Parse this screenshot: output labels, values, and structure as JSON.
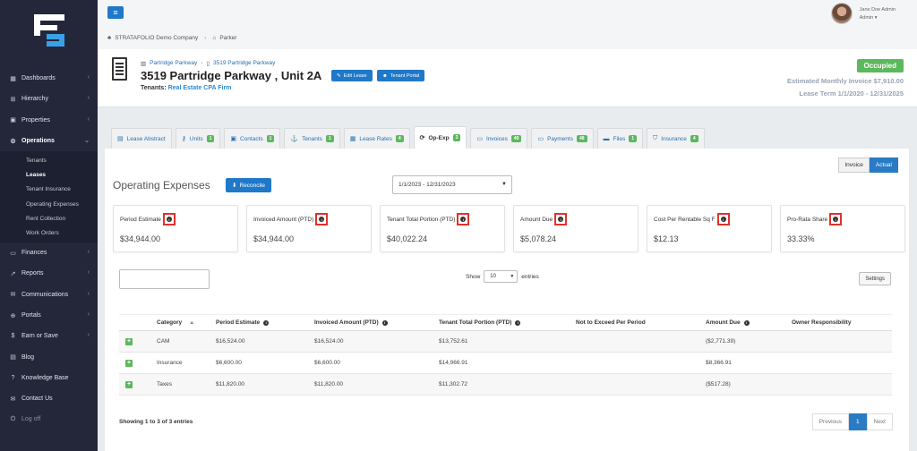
{
  "sidebar": {
    "items": [
      {
        "label": "Dashboards",
        "icon": "dashboard-icon"
      },
      {
        "label": "Hierarchy",
        "icon": "hierarchy-icon"
      },
      {
        "label": "Properties",
        "icon": "briefcase-icon"
      },
      {
        "label": "Operations",
        "icon": "gears-icon"
      },
      {
        "label": "Finances",
        "icon": "money-icon"
      },
      {
        "label": "Reports",
        "icon": "chart-icon"
      },
      {
        "label": "Communications",
        "icon": "chat-icon"
      },
      {
        "label": "Portals",
        "icon": "portal-icon"
      },
      {
        "label": "Earn or Save",
        "icon": "dollar-icon"
      },
      {
        "label": "Blog",
        "icon": "blog-icon"
      },
      {
        "label": "Knowledge Base",
        "icon": "question-icon"
      },
      {
        "label": "Contact Us",
        "icon": "envelope-icon"
      },
      {
        "label": "Log off",
        "icon": "power-icon"
      }
    ],
    "operations_sub": [
      "Tenants",
      "Leases",
      "Tenant Insurance",
      "Operating Expenses",
      "Rent Collection",
      "Work Orders"
    ]
  },
  "topbar": {
    "company": "STRATAFOLIO Demo Company",
    "property": "Parker",
    "user_name": "Jane Doe Admin",
    "user_role": "Admin ▾"
  },
  "lease": {
    "crumb_property": "Partridge Parkway",
    "crumb_unit": "3519 Partridge Parkway",
    "title": "3519 Partridge Parkway , Unit 2A",
    "edit_label": "Edit Lease",
    "portal_label": "Tenant Portal",
    "tenants_label": "Tenants:",
    "tenant_name": "Real Estate CPA Firm",
    "status": "Occupied",
    "est_invoice": "Estimated Monthly Invoice $7,910.00",
    "lease_term": "Lease Term 1/1/2020 - 12/31/2025"
  },
  "tabs": [
    {
      "label": "Lease Abstract",
      "badge": ""
    },
    {
      "label": "Units",
      "badge": "1"
    },
    {
      "label": "Contacts",
      "badge": "1"
    },
    {
      "label": "Tenants",
      "badge": "1"
    },
    {
      "label": "Lease Rates",
      "badge": "4"
    },
    {
      "label": "Op-Exp",
      "badge": "3"
    },
    {
      "label": "Invoices",
      "badge": "49"
    },
    {
      "label": "Payments",
      "badge": "48"
    },
    {
      "label": "Files",
      "badge": "1"
    },
    {
      "label": "Insurance",
      "badge": "4"
    }
  ],
  "main": {
    "toggle_invoice": "Invoice",
    "toggle_actual": "Actual",
    "title": "Operating Expenses",
    "reconcile_label": "Reconcile",
    "date_range": "1/1/2023 - 12/31/2023",
    "cards": [
      {
        "label": "Period Estimate",
        "value": "$34,944.00"
      },
      {
        "label": "Invoiced Amount (PTD)",
        "value": "$34,944.00"
      },
      {
        "label": "Tenant Total Portion (PTD)",
        "value": "$40,022.24"
      },
      {
        "label": "Amount Due",
        "value": "$5,078.24"
      },
      {
        "label": "Cost Per Rentable Sq F",
        "value": "$12.13"
      },
      {
        "label": "Pro-Rata Share",
        "value": "33.33%"
      }
    ],
    "show_label": "Show",
    "entries_value": "10",
    "entries_label": "entries",
    "settings_label": "Settings",
    "columns": [
      "Category",
      "Period Estimate",
      "Invoiced Amount (PTD)",
      "Tenant Total Portion (PTD)",
      "Not to Exceed Per Period",
      "Amount Due",
      "Owner Responsibility"
    ],
    "rows": [
      {
        "category": "CAM",
        "estimate": "$16,524.00",
        "invoiced": "$16,524.00",
        "portion": "$13,752.61",
        "nte": "",
        "due": "($2,771.39)",
        "owner": ""
      },
      {
        "category": "Insurance",
        "estimate": "$6,600.00",
        "invoiced": "$6,600.00",
        "portion": "$14,966.91",
        "nte": "",
        "due": "$8,366.91",
        "owner": ""
      },
      {
        "category": "Taxes",
        "estimate": "$11,820.00",
        "invoiced": "$11,820.00",
        "portion": "$11,302.72",
        "nte": "",
        "due": "($517.28)",
        "owner": ""
      }
    ],
    "showing": "Showing 1 to 3 of 3 entries",
    "prev": "Previous",
    "page": "1",
    "next": "Next"
  },
  "colors": {
    "sidebar": "#24273a",
    "primary": "#1f78c8",
    "success": "#5cb85c",
    "highlight": "#e0322d"
  }
}
